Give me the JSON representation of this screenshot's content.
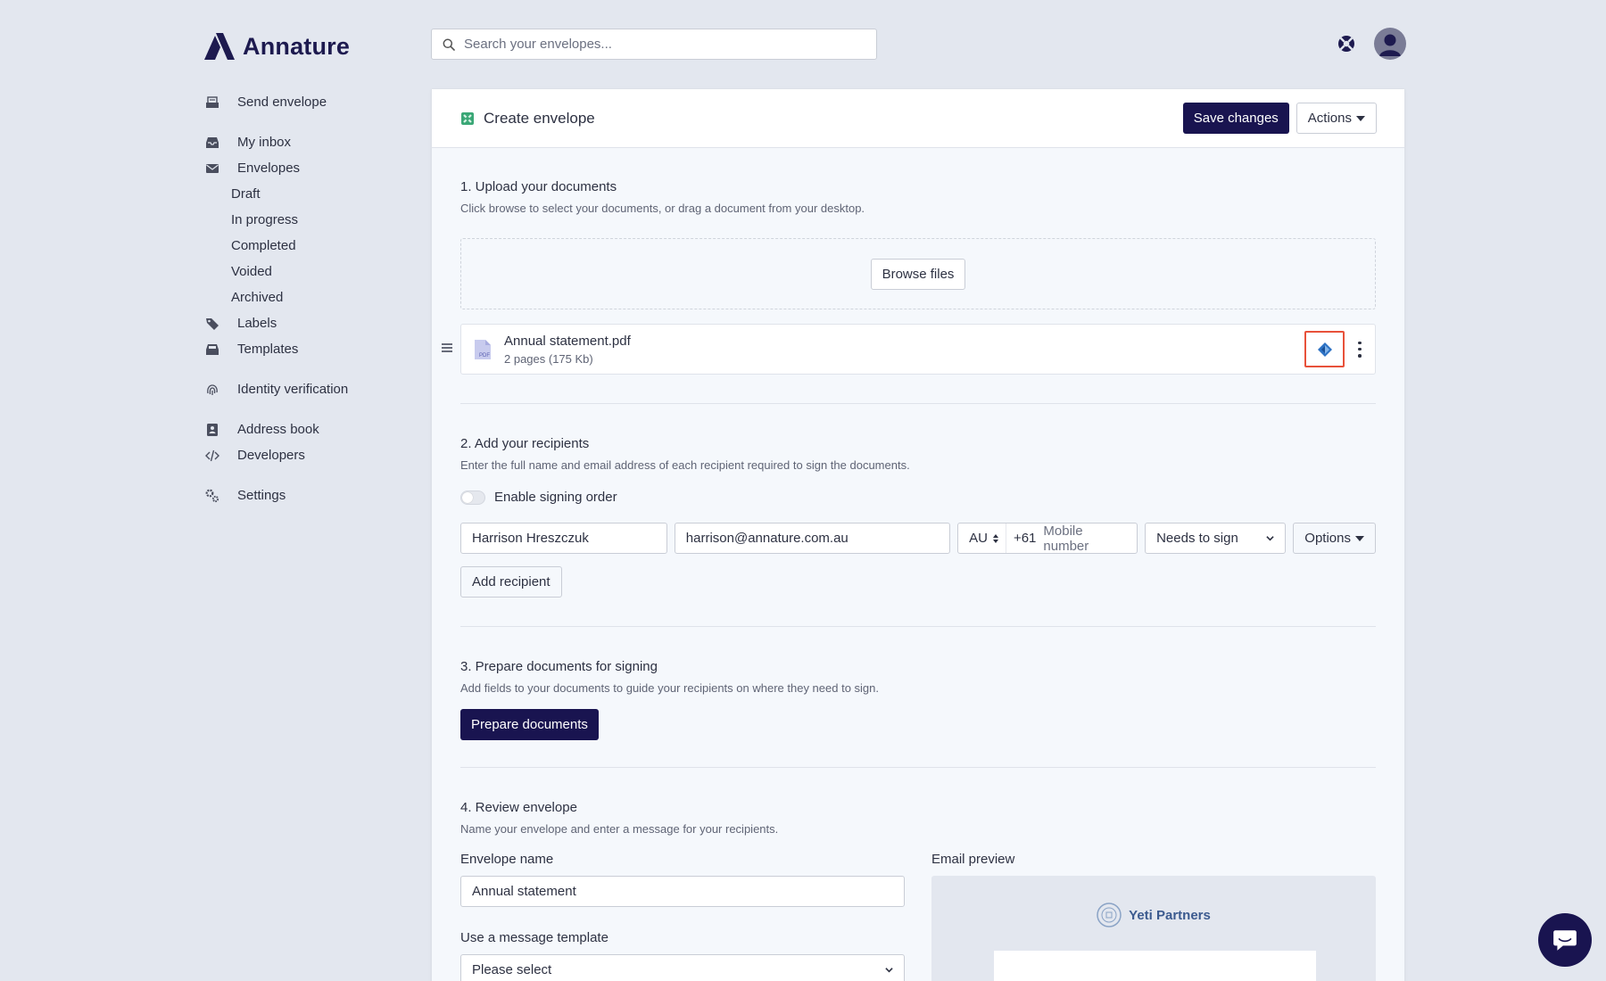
{
  "brand": {
    "name": "Annature"
  },
  "search": {
    "placeholder": "Search your envelopes..."
  },
  "sidebar": {
    "items": [
      {
        "label": "Send envelope",
        "icon": "send-envelope-icon"
      },
      {
        "label": "My inbox",
        "icon": "inbox-icon"
      },
      {
        "label": "Envelopes",
        "icon": "envelope-icon"
      },
      {
        "label": "Draft"
      },
      {
        "label": "In progress"
      },
      {
        "label": "Completed"
      },
      {
        "label": "Voided"
      },
      {
        "label": "Archived"
      },
      {
        "label": "Labels",
        "icon": "tag-icon"
      },
      {
        "label": "Templates",
        "icon": "templates-icon"
      },
      {
        "label": "Identity verification",
        "icon": "fingerprint-icon"
      },
      {
        "label": "Address book",
        "icon": "address-book-icon"
      },
      {
        "label": "Developers",
        "icon": "code-icon"
      },
      {
        "label": "Settings",
        "icon": "gears-icon"
      }
    ]
  },
  "header": {
    "title": "Create envelope",
    "save_label": "Save changes",
    "actions_label": "Actions"
  },
  "upload": {
    "heading": "1. Upload your documents",
    "desc": "Click browse to select your documents, or drag a document from your desktop.",
    "browse_label": "Browse files",
    "document": {
      "name": "Annual statement.pdf",
      "meta": "2 pages (175 Kb)"
    }
  },
  "recipients": {
    "heading": "2. Add your recipients",
    "desc": "Enter the full name and email address of each recipient required to sign the documents.",
    "signing_order_label": "Enable signing order",
    "row": {
      "name": "Harrison Hreszczuk",
      "email": "harrison@annature.com.au",
      "country": "AU",
      "dial_code": "+61",
      "mobile_placeholder": "Mobile number",
      "role": "Needs to sign",
      "options_label": "Options"
    },
    "add_label": "Add recipient"
  },
  "prepare": {
    "heading": "3. Prepare documents for signing",
    "desc": "Add fields to your documents to guide your recipients on where they need to sign.",
    "button_label": "Prepare documents"
  },
  "review": {
    "heading": "4. Review envelope",
    "desc": "Name your envelope and enter a message for your recipients.",
    "envelope_name_label": "Envelope name",
    "envelope_name_value": "Annual statement",
    "template_label": "Use a message template",
    "template_value": "Please select",
    "email_preview_label": "Email preview",
    "email_sender": "Yeti Partners"
  },
  "colors": {
    "primary": "#191450",
    "background": "#e3e7ef",
    "highlight": "#e8513a",
    "sign_icon": "#2d72c4"
  }
}
